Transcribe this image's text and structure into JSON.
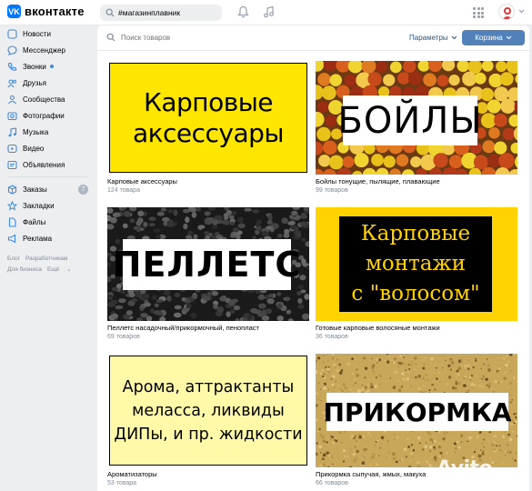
{
  "header": {
    "logo_text": "вконтакте",
    "logo_mark": "VK",
    "search_value": "#магазинплавник",
    "icons": [
      "search-icon",
      "bell-icon",
      "music-icon",
      "apps-grid-icon",
      "chevron-down-icon"
    ]
  },
  "sidebar": {
    "items": [
      {
        "label": "Новости",
        "icon": "news-icon"
      },
      {
        "label": "Мессенджер",
        "icon": "message-icon"
      },
      {
        "label": "Звонки",
        "icon": "phone-icon"
      },
      {
        "label": "Друзья",
        "icon": "friends-icon"
      },
      {
        "label": "Сообщества",
        "icon": "groups-icon"
      },
      {
        "label": "Фотографии",
        "icon": "photo-icon"
      },
      {
        "label": "Музыка",
        "icon": "music-icon"
      },
      {
        "label": "Видео",
        "icon": "video-icon"
      },
      {
        "label": "Объявления",
        "icon": "ads-icon"
      }
    ],
    "items2": [
      {
        "label": "Заказы",
        "icon": "orders-icon",
        "badge": "7"
      },
      {
        "label": "Закладки",
        "icon": "star-icon"
      },
      {
        "label": "Файлы",
        "icon": "file-icon"
      },
      {
        "label": "Реклама",
        "icon": "ad-icon"
      }
    ],
    "footer": {
      "blog": "Блог",
      "developers": "Разработчикам",
      "business": "Для бизнеса",
      "more": "Ещё"
    }
  },
  "toolbar": {
    "search_placeholder": "Поиск товаров",
    "params_label": "Параметры",
    "cart_label": "Корзина"
  },
  "products": [
    {
      "title": "Карповые аксессуары",
      "count": "124 товара",
      "banner": [
        "Карповые",
        "аксессуары"
      ]
    },
    {
      "title": "Бойлы тонущие, пылящие, плавающие",
      "count": "99 товаров",
      "banner": [
        "БОЙЛЫ"
      ]
    },
    {
      "title": "Пеллетс насадочный/прикормочный, пенопласт",
      "count": "69 товаров",
      "banner": [
        "ПЕЛЛЕТС"
      ]
    },
    {
      "title": "Готовые карповые волосяные монтажи",
      "count": "36 товаров",
      "banner": [
        "Карповые",
        "монтажи",
        "с \"волосом\""
      ]
    },
    {
      "title": "Ароматизаторы",
      "count": "53 товара",
      "banner": [
        "Арома, аттрактанты",
        "меласса, ликвиды",
        "ДИПы, и пр. жидкости"
      ]
    },
    {
      "title": "Прикормка сыпучая, жмых, макуха",
      "count": "66 товаров",
      "banner": [
        "ПРИКОРМКА"
      ]
    }
  ],
  "watermark": "Avito",
  "colors": {
    "accent": "#5181b8",
    "link": "#2a5885",
    "banner_yellow": "#ffe600",
    "muted": "#818c99"
  }
}
